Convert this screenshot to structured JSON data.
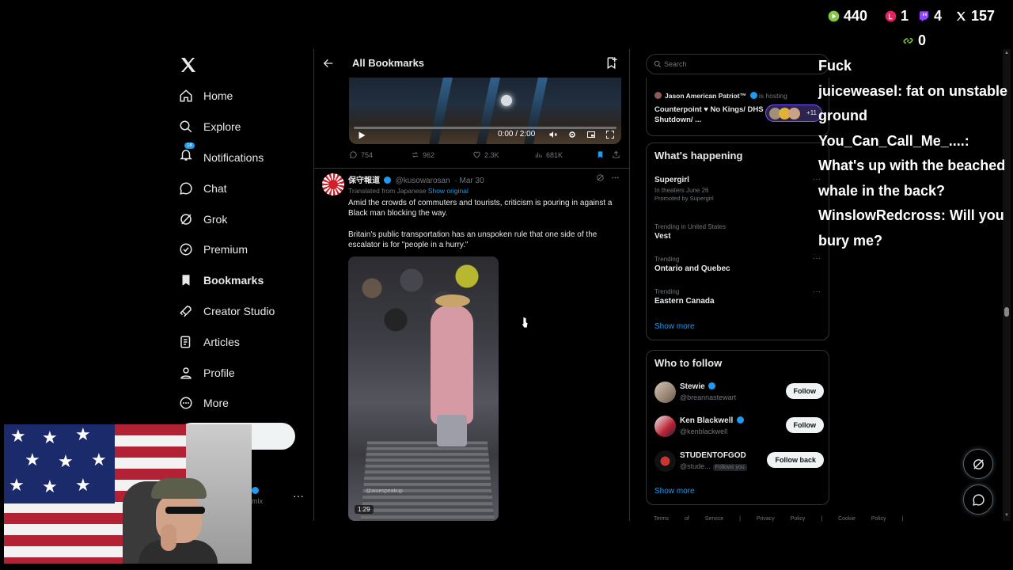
{
  "nav": {
    "items": [
      {
        "label": "Home",
        "icon": "home-icon"
      },
      {
        "label": "Explore",
        "icon": "search-icon"
      },
      {
        "label": "Notifications",
        "icon": "bell-icon",
        "badge": "18"
      },
      {
        "label": "Chat",
        "icon": "chat-icon"
      },
      {
        "label": "Grok",
        "icon": "grok-icon"
      },
      {
        "label": "Premium",
        "icon": "premium-icon"
      },
      {
        "label": "Bookmarks",
        "icon": "bookmark-icon",
        "active": true
      },
      {
        "label": "Creator Studio",
        "icon": "rocket-icon"
      },
      {
        "label": "Articles",
        "icon": "articles-icon"
      },
      {
        "label": "Profile",
        "icon": "person-icon"
      },
      {
        "label": "More",
        "icon": "more-circle-icon"
      }
    ],
    "account_more": "···",
    "account_handle_fragment": "mlx"
  },
  "feed": {
    "title": "All Bookmarks",
    "video": {
      "time": "0:00 / 2:00"
    },
    "actions": {
      "replies": "754",
      "reposts": "962",
      "likes": "2.3K",
      "views": "681K"
    },
    "tweet": {
      "name": "保守報道",
      "handle": "@kusowarosan",
      "date": "· Mar 30",
      "translated": "Translated from Japanese",
      "show_original": "Show original",
      "paragraph1": "Amid the crowds of commuters and tourists, criticism is pouring in against a Black man blocking the way.",
      "paragraph2": "Britain's public transportation has an unspoken rule that one side of the escalator is for \"people in a hurry.\"",
      "media_watermark": "@aiuespeakup",
      "media_duration": "1:29"
    }
  },
  "right": {
    "search_placeholder": "Search",
    "space": {
      "host": "Jason American Patriot™",
      "hosting": "is hosting",
      "title": "Counterpoint ♥ No Kings/ DHS Shutdown/ ...",
      "extra": "+11"
    },
    "happening": {
      "title": "What's happening",
      "trends": [
        {
          "meta": "",
          "name": "Supergirl",
          "sub": "In theaters June 26",
          "promo": "Promoted by Supergirl"
        },
        {
          "meta": "Trending in United States",
          "name": "Vest"
        },
        {
          "meta": "Trending",
          "name": "Ontario and Quebec"
        },
        {
          "meta": "Trending",
          "name": "Eastern Canada"
        }
      ],
      "show_more": "Show more"
    },
    "who_to_follow": {
      "title": "Who to follow",
      "accounts": [
        {
          "name": "Stewie",
          "handle": "@breannastewart",
          "button": "Follow"
        },
        {
          "name": "Ken Blackwell",
          "handle": "@kenblackwell",
          "button": "Follow"
        },
        {
          "name": "STUDENTOFGOD",
          "handle": "@stude...",
          "follows_you": "Follows you",
          "button": "Follow back"
        }
      ],
      "show_more": "Show more"
    },
    "footer": "Terms of Service | Privacy Policy | Cookie Policy |"
  },
  "overlay": {
    "stats": {
      "rumble": "440",
      "other": "1",
      "twitch": "4",
      "x": "157",
      "link": "0"
    },
    "chat": [
      "Fuck",
      "juiceweasel: fat on unstable ground",
      "You_Can_Call_Me_....: What's up with the beached whale in the back?",
      "WinslowRedcross: Will you bury me?"
    ]
  },
  "colors": {
    "accent": "#1d9bf0",
    "background": "#000000",
    "text": "#e7e9ea",
    "muted": "#71767b",
    "like_heart": "#f91880"
  }
}
